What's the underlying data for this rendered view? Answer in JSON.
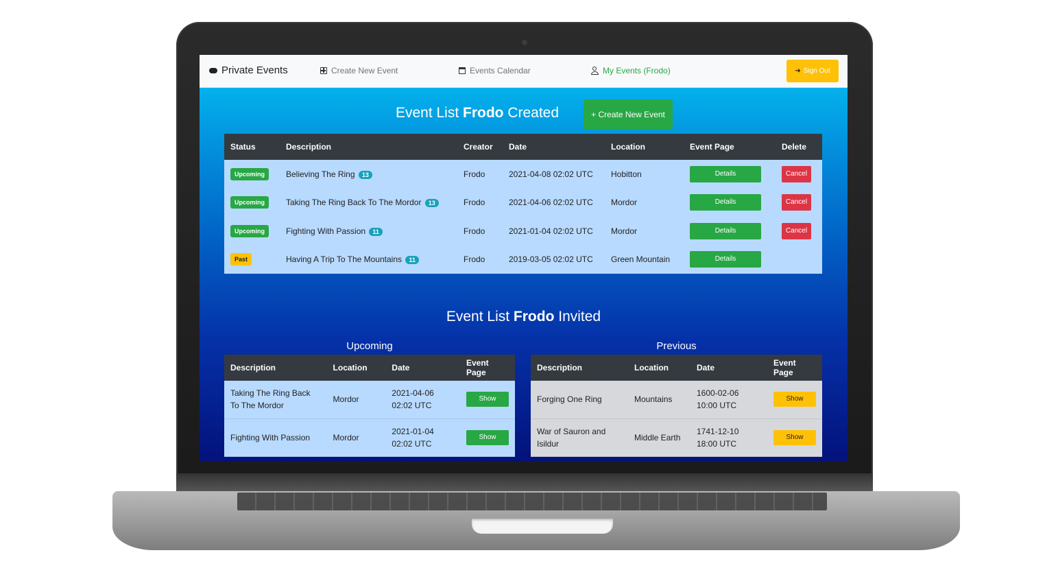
{
  "nav": {
    "brand": "Private Events",
    "create_event": "Create New Event",
    "calendar": "Events Calendar",
    "my_events": "My Events (Frodo)",
    "sign_out": "Sign Out"
  },
  "created": {
    "title_prefix": "Event List ",
    "title_name": "Frodo",
    "title_suffix": " Created",
    "create_button": "+ Create New Event",
    "headers": [
      "Status",
      "Description",
      "Creator",
      "Date",
      "Location",
      "Event Page",
      "Delete"
    ],
    "rows": [
      {
        "status": "Upcoming",
        "description": "Believing The Ring",
        "count": "13",
        "creator": "Frodo",
        "date": "2021-04-08 02:02 UTC",
        "location": "Hobitton",
        "details": "Details",
        "cancel": "Cancel"
      },
      {
        "status": "Upcoming",
        "description": "Taking The Ring Back To The Mordor",
        "count": "13",
        "creator": "Frodo",
        "date": "2021-04-06 02:02 UTC",
        "location": "Mordor",
        "details": "Details",
        "cancel": "Cancel"
      },
      {
        "status": "Upcoming",
        "description": "Fighting With Passion",
        "count": "11",
        "creator": "Frodo",
        "date": "2021-01-04 02:02 UTC",
        "location": "Mordor",
        "details": "Details",
        "cancel": "Cancel"
      },
      {
        "status": "Past",
        "description": "Having A Trip To The Mountains",
        "count": "11",
        "creator": "Frodo",
        "date": "2019-03-05 02:02 UTC",
        "location": "Green Mountain",
        "details": "Details",
        "cancel": ""
      }
    ]
  },
  "invited": {
    "title_prefix": "Event List ",
    "title_name": "Frodo",
    "title_suffix": " Invited",
    "upcoming": {
      "label": "Upcoming",
      "headers": [
        "Description",
        "Location",
        "Date",
        "Event Page"
      ],
      "rows": [
        {
          "description": "Taking The Ring Back To The Mordor",
          "location": "Mordor",
          "date": "2021-04-06 02:02 UTC",
          "action": "Show"
        },
        {
          "description": "Fighting With Passion",
          "location": "Mordor",
          "date": "2021-01-04 02:02 UTC",
          "action": "Show"
        }
      ]
    },
    "previous": {
      "label": "Previous",
      "headers": [
        "Description",
        "Location",
        "Date",
        "Event Page"
      ],
      "rows": [
        {
          "description": "Forging One Ring",
          "location": "Mountains",
          "date": "1600-02-06 10:00 UTC",
          "action": "Show"
        },
        {
          "description": "War of Sauron and Isildur",
          "location": "Middle Earth",
          "date": "1741-12-10 18:00 UTC",
          "action": "Show"
        }
      ]
    }
  },
  "colors": {
    "success": "#28a745",
    "warning": "#ffc107",
    "danger": "#dc3545",
    "info": "#17a2b8",
    "table_header": "#343a40",
    "row_primary": "#b8daff",
    "row_secondary": "#d6d8db"
  },
  "icons": {
    "brand": "event-pill-icon",
    "create": "plus-square-icon",
    "calendar": "calendar-icon",
    "user": "user-icon",
    "sign_out": "sign-out-icon"
  }
}
